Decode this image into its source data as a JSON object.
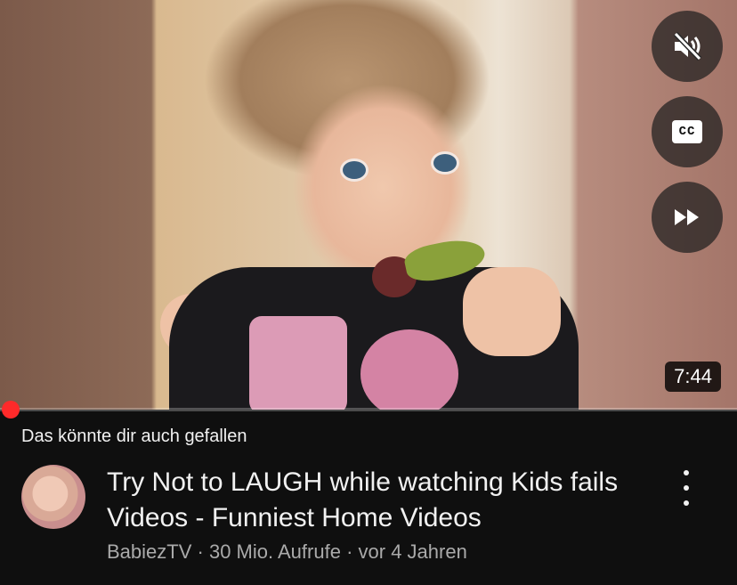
{
  "player": {
    "duration": "7:44",
    "progress": 0.0,
    "controls": {
      "mute_icon": "speaker-muted-icon",
      "captions_label": "CC",
      "skip_icon": "fast-forward-icon"
    }
  },
  "recommendations": {
    "section_title": "Das könnte dir auch gefallen",
    "video": {
      "title": "Try Not to LAUGH while watching Kids fails Videos - Funniest Home Videos",
      "channel": "BabiezTV",
      "views": "30 Mio. Aufrufe",
      "age": "vor 4 Jahren",
      "separator": "·"
    }
  },
  "colors": {
    "background": "#0f0f0f",
    "progress_dot": "#ff2a2a",
    "meta_text": "#aaaaaa"
  }
}
